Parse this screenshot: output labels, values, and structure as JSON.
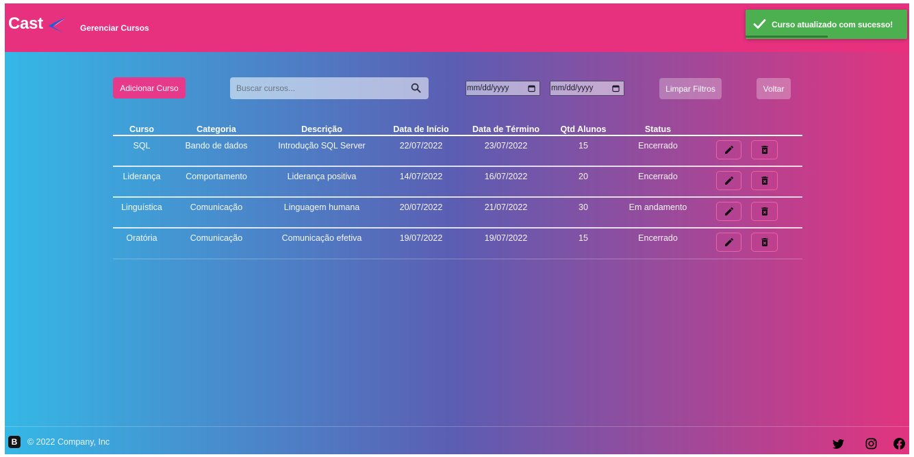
{
  "header": {
    "logo_text": "Cast",
    "title": "Gerenciar Cursos"
  },
  "toast": {
    "icon": "check-icon",
    "message": "Curso atualizado com sucesso!",
    "progress": 0.51
  },
  "toolbar": {
    "add_button": "Adicionar Curso",
    "search": {
      "placeholder": "Buscar cursos...",
      "icon": "search-icon"
    },
    "date_start": {
      "placeholder": "mm/dd/yyyy",
      "icon": "calendar-icon"
    },
    "date_end": {
      "placeholder": "mm/dd/yyyy",
      "icon": "calendar-icon"
    },
    "clear_button": "Limpar Filtros",
    "back_button": "Voltar"
  },
  "table": {
    "columns": [
      "Curso",
      "Categoria",
      "Descrição",
      "Data de Início",
      "Data de Término",
      "Qtd Alunos",
      "Status"
    ],
    "rows": [
      {
        "curso": "SQL",
        "categoria": "Bando de dados",
        "descricao": "Introdução SQL Server",
        "inicio": "22/07/2022",
        "termino": "23/07/2022",
        "alunos": 15,
        "status": "Encerrado"
      },
      {
        "curso": "Liderança",
        "categoria": "Comportamento",
        "descricao": "Liderança positiva",
        "inicio": "14/07/2022",
        "termino": "16/07/2022",
        "alunos": 20,
        "status": "Encerrado"
      },
      {
        "curso": "Linguística",
        "categoria": "Comunicação",
        "descricao": "Linguagem humana",
        "inicio": "20/07/2022",
        "termino": "21/07/2022",
        "alunos": 30,
        "status": "Em andamento"
      },
      {
        "curso": "Oratória",
        "categoria": "Comunicação",
        "descricao": "Comunicação efetiva",
        "inicio": "19/07/2022",
        "termino": "19/07/2022",
        "alunos": 15,
        "status": "Encerrado"
      }
    ],
    "row_actions": {
      "edit_icon": "pencil-icon",
      "delete_icon": "trash-x-icon"
    }
  },
  "footer": {
    "brand_icon": "bootstrap-icon",
    "brand_letter": "B",
    "copyright": "© 2022 Company, Inc",
    "social_icons": [
      "twitter-icon",
      "instagram-icon",
      "facebook-icon"
    ]
  },
  "colors": {
    "header_bg": "#e7317f",
    "gradient_left": "#35b8e6",
    "gradient_mid": "#5c5db2",
    "gradient_right": "#e2347f",
    "accent_pink": "#e6398a",
    "toast_green": "#4caf50",
    "toast_progress": "#2e7d32"
  }
}
